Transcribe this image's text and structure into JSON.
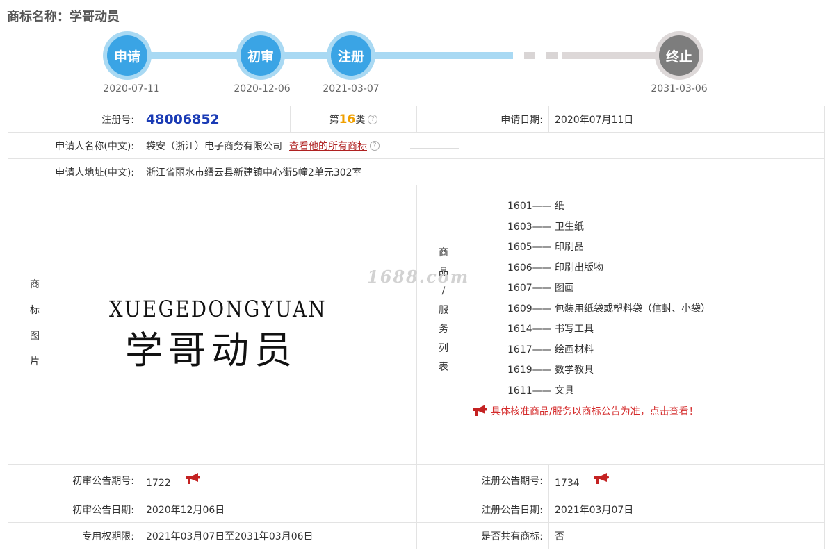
{
  "page_title": "商标名称：学哥动员",
  "timeline": [
    {
      "label": "申请",
      "date": "2020-07-11",
      "state": "done"
    },
    {
      "label": "初审",
      "date": "2020-12-06",
      "state": "done"
    },
    {
      "label": "注册",
      "date": "2021-03-07",
      "state": "done"
    },
    {
      "label": "终止",
      "date": "2031-03-06",
      "state": "todo"
    }
  ],
  "rows": {
    "reg_no_label": "注册号:",
    "reg_no": "48006852",
    "class_prefix": "第",
    "class_num": "16",
    "class_suffix": "类",
    "apply_date_label": "申请日期:",
    "apply_date": "2020年07月11日",
    "applicant_label": "申请人名称(中文):",
    "applicant": "袋安（浙江）电子商务有限公司",
    "all_marks_link": "查看他的所有商标",
    "address_label": "申请人地址(中文):",
    "address": "浙江省丽水市缙云县新建镇中心街5幢2单元302室",
    "mark_img_label": [
      "商",
      "标",
      "图",
      "片"
    ],
    "mark_en": "XUEGEDONGYUAN",
    "mark_cn": "学哥动员",
    "goods_label": [
      "商",
      "品",
      "/",
      "服",
      "务",
      "列",
      "表"
    ],
    "goods": [
      {
        "code": "1601——",
        "name": "纸"
      },
      {
        "code": "1603——",
        "name": "卫生纸"
      },
      {
        "code": "1605——",
        "name": "印刷品"
      },
      {
        "code": "1606——",
        "name": "印刷出版物"
      },
      {
        "code": "1607——",
        "name": "图画"
      },
      {
        "code": "1609——",
        "name": "包装用纸袋或塑料袋（信封、小袋）"
      },
      {
        "code": "1614——",
        "name": "书写工具"
      },
      {
        "code": "1617——",
        "name": "绘画材料"
      },
      {
        "code": "1619——",
        "name": "数学教具"
      },
      {
        "code": "1611——",
        "name": "文具"
      }
    ],
    "notice": "具体核准商品/服务以商标公告为准，点击查看！",
    "prelim_no_label": "初审公告期号:",
    "prelim_no": "1722",
    "reg_ann_no_label": "注册公告期号:",
    "reg_ann_no": "1734",
    "prelim_date_label": "初审公告日期:",
    "prelim_date": "2020年12月06日",
    "reg_ann_date_label": "注册公告日期:",
    "reg_ann_date": "2021年03月07日",
    "exclusive_label": "专用权期限:",
    "exclusive": "2021年03月07日至2031年03月06日",
    "shared_label": "是否共有商标:",
    "shared": "否"
  },
  "watermark": "1688.com",
  "colors": {
    "accent": "#3aa4e5",
    "accent_light": "#a9d9f3",
    "link": "#b02222",
    "notice": "#d42b2b",
    "class_num": "#f0a000",
    "reg_no": "#1a3bb5"
  },
  "icons": [
    "question-icon",
    "horn-icon"
  ]
}
